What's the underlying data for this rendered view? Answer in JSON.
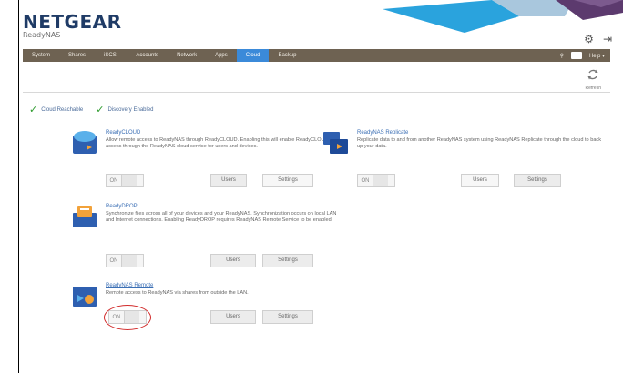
{
  "brand": {
    "logo": "NETGEAR",
    "product": "ReadyNAS"
  },
  "nav": {
    "tabs": [
      "System",
      "Shares",
      "iSCSI",
      "Accounts",
      "Network",
      "Apps",
      "Cloud",
      "Backup"
    ],
    "active_index": 6,
    "help_label": "Help",
    "help_caret": "▾"
  },
  "refresh": {
    "label": "Refresh"
  },
  "status": {
    "remote_access": "Cloud Reachable",
    "discovery": "Discovery Enabled"
  },
  "services": [
    {
      "title": "ReadyCLOUD",
      "description": "Allow remote access to ReadyNAS through ReadyCLOUD. Enabling this will enable ReadyCLOUD access through the ReadyNAS cloud service for users and devices.",
      "toggle": "ON",
      "buttons": [
        "Users",
        "Settings"
      ]
    },
    {
      "title": "ReadyNAS Replicate",
      "description": "Replicate data to and from another ReadyNAS system using ReadyNAS Replicate through the cloud to back up your data.",
      "toggle": "ON",
      "buttons": [
        "Users",
        "Settings"
      ]
    },
    {
      "title": "ReadyDROP",
      "description": "Synchronize files across all of your devices and your ReadyNAS. Synchronization occurs on local LAN and Internet connections. Enabling ReadyDROP requires ReadyNAS Remote Service to be enabled.",
      "toggle": "ON",
      "buttons": [
        "Users",
        "Settings"
      ]
    },
    {
      "title": "ReadyNAS Remote",
      "description": "Remote access to ReadyNAS via shares from outside the LAN.",
      "toggle": "ON",
      "buttons": [
        "Users",
        "Settings"
      ]
    }
  ],
  "colors": {
    "nav_bg": "#6e6252",
    "nav_active": "#3b8ad9",
    "link": "#3b6fb5",
    "highlight_circle": "#d12a2a",
    "status_check": "#2e9b2e"
  }
}
